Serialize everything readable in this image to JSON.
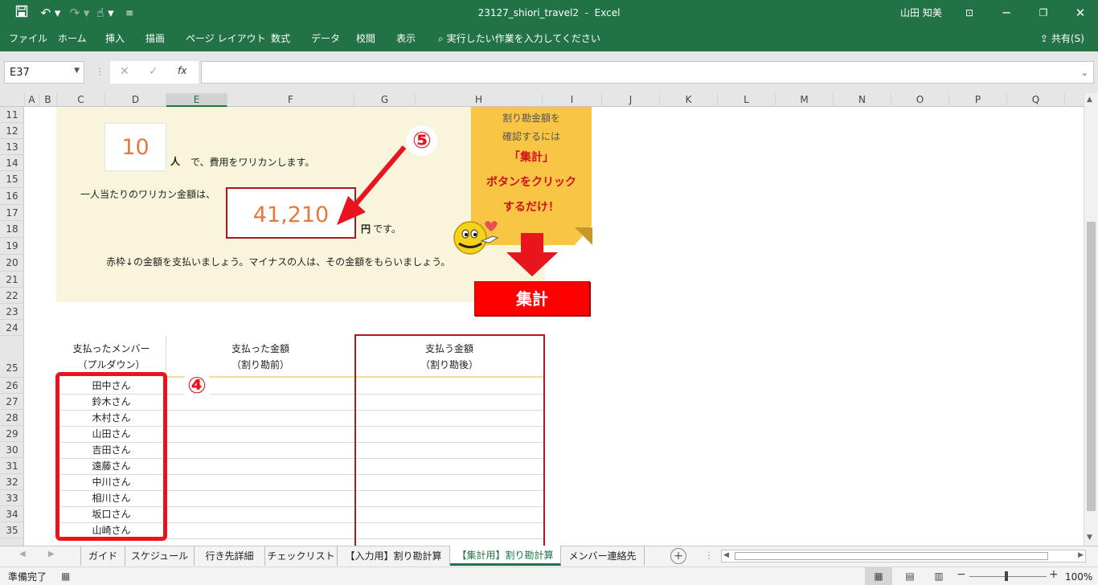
{
  "titlebar": {
    "filename": "23127_shiori_travel2",
    "separator": "-",
    "app": "Excel",
    "user": "山田 知美"
  },
  "ribbon": {
    "tabs": [
      "ファイル",
      "ホーム",
      "挿入",
      "描画",
      "ページ レイアウト",
      "数式",
      "データ",
      "校閲",
      "表示"
    ],
    "tell_me": "実行したい作業を入力してください",
    "share": "共有(S)"
  },
  "formula_bar": {
    "name_box": "E37",
    "fx": "fx",
    "value": ""
  },
  "columns": [
    "A",
    "B",
    "C",
    "D",
    "E",
    "F",
    "G",
    "H",
    "I",
    "J",
    "K",
    "L",
    "M",
    "N",
    "O",
    "P",
    "Q"
  ],
  "rows": [
    "11",
    "12",
    "13",
    "14",
    "15",
    "16",
    "17",
    "18",
    "19",
    "20",
    "21",
    "22",
    "23",
    "24",
    "25",
    "26",
    "27",
    "28",
    "29",
    "30",
    "31",
    "32",
    "33",
    "34",
    "35"
  ],
  "sheet": {
    "people_count": "10",
    "people_unit": "人",
    "people_text": "で、費用をワリカンします。",
    "per_person_label": "一人当たりのワリカン金額は、",
    "per_person_amount": "41,210",
    "yen_unit": "円",
    "yen_text": "です。",
    "instruction": "赤枠↓の金額を支払いましょう。マイナスの人は、その金額をもらいましょう。",
    "callout_num_5": "⑤",
    "callout_num_4": "④",
    "sticky_line1": "割り勘金額を",
    "sticky_line2": "確認するには",
    "sticky_line3": "「集計」",
    "sticky_line4": "ボタンをクリック",
    "sticky_line5": "するだけ！",
    "aggregate_button": "集計"
  },
  "table": {
    "col1_line1": "支払ったメンバー",
    "col1_line2": "（プルダウン）",
    "col2_line1": "支払った金額",
    "col2_line2": "（割り勘前）",
    "col3_line1": "支払う金額",
    "col3_line2": "（割り勘後）",
    "members": [
      "田中さん",
      "鈴木さん",
      "木村さん",
      "山田さん",
      "吉田さん",
      "遠藤さん",
      "中川さん",
      "相川さん",
      "坂口さん",
      "山崎さん"
    ]
  },
  "sheet_tabs": {
    "tabs": [
      "ガイド",
      "スケジュール",
      "行き先詳細",
      "チェックリスト",
      "【入力用】割り勘計算",
      "【集計用】割り勘計算",
      "メンバー連絡先"
    ],
    "active_index": 5
  },
  "status": {
    "ready": "準備完了",
    "zoom": "100%"
  },
  "colors": {
    "excel_green": "#217346",
    "panel_bg": "#f9f5dc",
    "amount_orange": "#e8783c",
    "red": "#e8141e",
    "sticky_yellow": "#f8c545"
  }
}
